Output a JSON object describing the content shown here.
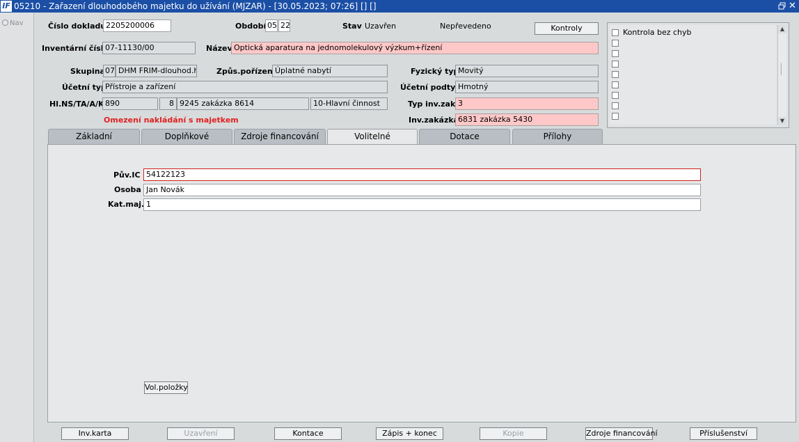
{
  "window": {
    "title": "05210 - Zařazení dlouhodobého majetku do užívání (MJZAR) - [30.05.2023; 07:26]  [] []",
    "app_icon_text": "IF"
  },
  "nav": {
    "label": "Nav"
  },
  "header": {
    "doc_no_label": "Číslo dokladu",
    "doc_no_value": "2205200006",
    "period_label": "Období",
    "period_month": "05",
    "period_year": "22",
    "status_label": "Stav",
    "status_value": "Uzavřen",
    "transfer_status": "Nepřevedeno",
    "check_button": "Kontroly",
    "inventory_no_label": "Inventární číslo",
    "inventory_no_value": "07-11130/00",
    "name_label": "Název",
    "name_value": "Optická aparatura na jednomolekulový výzkum+řízení",
    "group_label": "Skupina",
    "group_code": "07",
    "group_name": "DHM FRIM-dlouhod.hmo",
    "acquisition_label": "Způs.pořízení",
    "acquisition_value": "Úplatné nabytí",
    "physical_type_label": "Fyzický typ",
    "physical_type_value": "Movitý",
    "accounting_type_label": "Účetní typ",
    "accounting_type_value": "Přístroje a zařízení",
    "accounting_subtype_label": "Účetní podtyp",
    "accounting_subtype_value": "Hmotný",
    "hlns_label": "Hl.NS/TA/A/KP",
    "hlns_value": "890",
    "ta_value": "8",
    "a_value": "9245 zakázka 8614",
    "kp_value": "10-Hlavní činnost",
    "inv_order_type_label": "Typ inv.zak.",
    "inv_order_type_value": "3",
    "restriction_warning": "Omezení nakládání s majetkem",
    "inv_order_label": "Inv.zakázka",
    "inv_order_value": "6831 zakázka 5430"
  },
  "errors": {
    "items": [
      "Kontrola bez chyb",
      "",
      "",
      "",
      "",
      "",
      "",
      "",
      "",
      ""
    ]
  },
  "tabs": [
    {
      "label": "Základní"
    },
    {
      "label": "Doplňkové"
    },
    {
      "label": "Zdroje financování"
    },
    {
      "label": "Volitelné"
    },
    {
      "label": "Dotace"
    },
    {
      "label": "Přílohy"
    }
  ],
  "optional": {
    "puv_ic_label": "Pův.IC",
    "puv_ic_value": "54122123",
    "person_label": "Osoba",
    "person_value": "Jan Novák",
    "category_label": "Kat.maj.",
    "category_value": "1",
    "items_button": "Vol.položky"
  },
  "footer": {
    "inv_card": "Inv.karta",
    "close": "Uzavření",
    "contacts": "Kontace",
    "save_exit": "Zápis + konec",
    "copy": "Kopie",
    "funding": "Zdroje financování",
    "accessories": "Příslušenství"
  },
  "colors": {
    "titlebar": "#1b4fa6",
    "required_field": "#ffc8c8",
    "warning_text": "#e02020"
  }
}
